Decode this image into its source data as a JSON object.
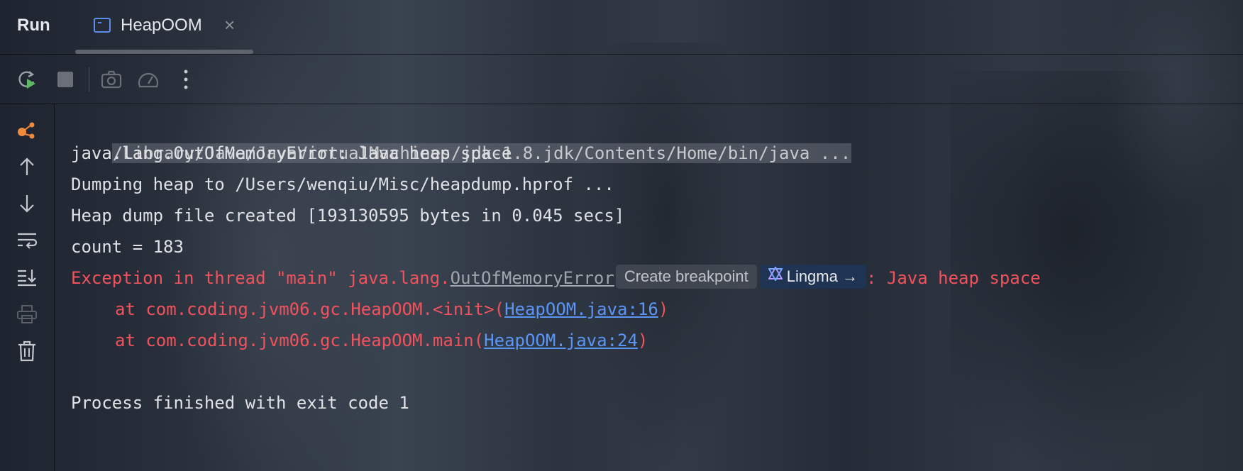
{
  "header": {
    "run_title": "Run",
    "tab": {
      "label": "HeapOOM",
      "close_glyph": "×",
      "icon": "console-window-icon"
    }
  },
  "toolbar": {
    "icons": [
      "rerun-icon",
      "stop-icon",
      "screenshot-icon",
      "profiler-icon",
      "more-icon"
    ]
  },
  "gutter": {
    "icons": [
      "debug-branch-icon",
      "arrow-up-icon",
      "arrow-down-icon",
      "soft-wrap-icon",
      "scroll-to-end-icon",
      "print-icon",
      "trash-icon"
    ]
  },
  "console": {
    "command": "/Library/Java/JavaVirtualMachines/jdk-1.8.jdk/Contents/Home/bin/java ...",
    "line_oom": "java.lang.OutOfMemoryError: Java heap space",
    "line_dumping": "Dumping heap to /Users/wenqiu/Misc/heapdump.hprof ...",
    "line_created": "Heap dump file created [193130595 bytes in 0.045 secs]",
    "line_count": "count = 183",
    "exception": {
      "prefix": "Exception in thread \"main\" java.lang.",
      "class": "OutOfMemoryError",
      "create_breakpoint": "Create breakpoint",
      "lingma": "Lingma →",
      "suffix": ": Java heap space"
    },
    "stack": [
      {
        "prefix": "at com.coding.jvm06.gc.HeapOOM.<init>(",
        "link": "HeapOOM.java:16",
        "suffix": ")"
      },
      {
        "prefix": "at com.coding.jvm06.gc.HeapOOM.main(",
        "link": "HeapOOM.java:24",
        "suffix": ")"
      }
    ],
    "line_finished": "Process finished with exit code 1"
  },
  "colors": {
    "error": "#f2525d",
    "link": "#5b95f5",
    "accent": "#f08a3c"
  }
}
